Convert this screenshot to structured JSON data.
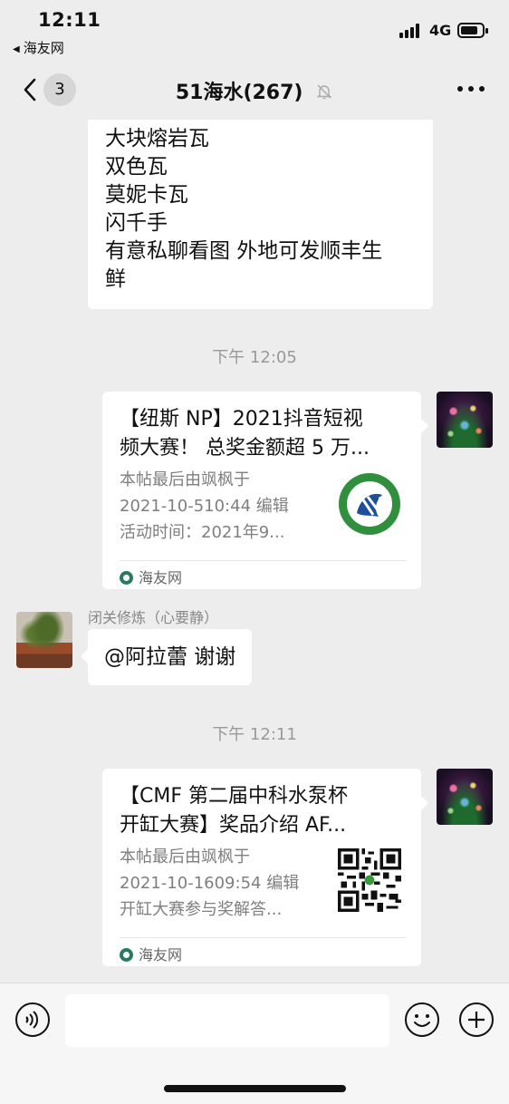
{
  "status_bar": {
    "time": "12:11",
    "back_app": "海友网",
    "network": "4G",
    "battery_level": 0.8
  },
  "nav": {
    "unread_count": "3",
    "title": "51海水(267)"
  },
  "messages": {
    "first_bubble_lines": [
      "大块熔岩瓦",
      "双色瓦",
      "莫妮卡瓦",
      "闪千手",
      "有意私聊看图 外地可发顺丰生",
      "鲜"
    ],
    "time_1": "下午 12:05",
    "card_1": {
      "title_line_1": "【纽斯 NP】2021抖音短视",
      "title_line_2": "频大赛！ 总奖金额超 5 万...",
      "desc_line_1": "本帖最后由飒枫于",
      "desc_line_2": "2021-10-510:44 编辑",
      "desc_line_3": "活动时间：2021年9...",
      "source": "海友网"
    },
    "sender_2": "闭关修炼（心要静）",
    "text_2": "@阿拉蕾 谢谢",
    "time_2": "下午 12:11",
    "card_2": {
      "title_line_1": "【CMF 第二届中科水泵杯",
      "title_line_2": "开缸大赛】奖品介绍 AF...",
      "desc_line_1": "本帖最后由飒枫于",
      "desc_line_2": "2021-10-1609:54 编辑",
      "desc_line_3": "开缸大赛参与奖解答...",
      "source": "海友网"
    }
  },
  "input": {
    "placeholder": ""
  }
}
